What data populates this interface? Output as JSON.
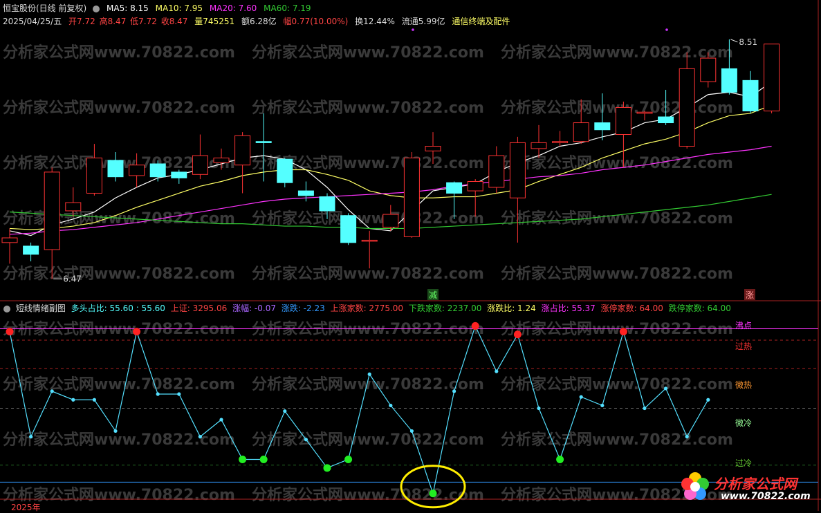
{
  "header": {
    "title": "恒宝股份(日线 前复权)",
    "ma5": "MA5: 8.15",
    "ma10": "MA10: 7.95",
    "ma20": "MA20: 7.60",
    "ma60": "MA60: 7.19",
    "date": "2025/04/25/五",
    "open": "开7.72",
    "high": "高8.47",
    "low": "低7.72",
    "close": "收8.47",
    "volume": "量745251",
    "amount": "额6.28亿",
    "change": "幅0.77(10.00%)",
    "turnover": "换12.44%",
    "float": "流通5.99亿",
    "link": "通信终端及配件"
  },
  "main_chart": {
    "high_label": "8.51",
    "low_label": "6.47",
    "marker_jian": "减",
    "marker_zhang": "涨"
  },
  "sub_header": {
    "title": "短线情绪副图",
    "duokong": "多头占比: 55.60 : 55.60",
    "shangzheng": "上证: 3295.06",
    "zhangfu": "涨幅: -0.07",
    "zhangdie": "涨跌: -2.23",
    "up_count": "上涨家数: 2775.00",
    "down_count": "下跌家数: 2237.00",
    "ratio": "涨跌比: 1.24",
    "up_pct": "涨占比: 55.37",
    "limit_up": "涨停家数: 64.00",
    "limit_down": "跌停家数: 64.00"
  },
  "levels": {
    "boil": "沸点",
    "overheat": "过热",
    "warm": "微热",
    "cool": "微冷",
    "overcold": "过冷"
  },
  "footer": {
    "year": "2025年"
  },
  "watermark": "分析家公式网www.70822.com",
  "brand": {
    "name": "分析家公式网",
    "url": "www.70822.com"
  },
  "colors": {
    "up": "#ff3333",
    "down": "#54ffff",
    "ma5": "#ffffff",
    "ma10": "#ffff66",
    "ma20": "#ff33ff",
    "ma60": "#33cc33",
    "sentiment": "#54e0ff"
  },
  "candles": [
    {
      "o": 6.78,
      "c": 6.82,
      "h": 6.9,
      "l": 6.6
    },
    {
      "o": 6.75,
      "c": 6.68,
      "h": 6.78,
      "l": 6.62
    },
    {
      "o": 6.72,
      "c": 7.38,
      "h": 7.42,
      "l": 6.47
    },
    {
      "o": 7.05,
      "c": 7.12,
      "h": 7.25,
      "l": 7.0
    },
    {
      "o": 7.2,
      "c": 7.5,
      "h": 7.62,
      "l": 7.18
    },
    {
      "o": 7.48,
      "c": 7.34,
      "h": 7.55,
      "l": 7.3
    },
    {
      "o": 7.35,
      "c": 7.44,
      "h": 7.54,
      "l": 7.25
    },
    {
      "o": 7.45,
      "c": 7.34,
      "h": 7.48,
      "l": 7.3
    },
    {
      "o": 7.38,
      "c": 7.33,
      "h": 7.4,
      "l": 7.28
    },
    {
      "o": 7.36,
      "c": 7.52,
      "h": 7.7,
      "l": 7.32
    },
    {
      "o": 7.46,
      "c": 7.5,
      "h": 7.58,
      "l": 7.4
    },
    {
      "o": 7.44,
      "c": 7.69,
      "h": 7.72,
      "l": 7.2
    },
    {
      "o": 7.64,
      "c": 7.63,
      "h": 7.88,
      "l": 7.3
    },
    {
      "o": 7.49,
      "c": 7.29,
      "h": 7.5,
      "l": 7.25
    },
    {
      "o": 7.22,
      "c": 7.18,
      "h": 7.3,
      "l": 7.13
    },
    {
      "o": 7.17,
      "c": 7.05,
      "h": 7.2,
      "l": 6.98
    },
    {
      "o": 7.01,
      "c": 6.78,
      "h": 7.03,
      "l": 6.76
    },
    {
      "o": 6.8,
      "c": 6.8,
      "h": 6.88,
      "l": 6.56
    },
    {
      "o": 6.91,
      "c": 7.02,
      "h": 7.1,
      "l": 6.88
    },
    {
      "o": 6.83,
      "c": 7.5,
      "h": 7.55,
      "l": 6.82
    },
    {
      "o": 7.56,
      "c": 7.6,
      "h": 7.72,
      "l": 7.45
    },
    {
      "o": 7.29,
      "c": 7.2,
      "h": 7.3,
      "l": 6.98
    },
    {
      "o": 7.22,
      "c": 7.3,
      "h": 7.32,
      "l": 7.0
    },
    {
      "o": 7.25,
      "c": 7.52,
      "h": 7.6,
      "l": 7.2
    },
    {
      "o": 7.16,
      "c": 7.63,
      "h": 7.68,
      "l": 6.78
    },
    {
      "o": 7.58,
      "c": 7.63,
      "h": 7.78,
      "l": 7.5
    },
    {
      "o": 7.63,
      "c": 7.64,
      "h": 7.73,
      "l": 7.6
    },
    {
      "o": 7.64,
      "c": 7.8,
      "h": 8.0,
      "l": 7.62
    },
    {
      "o": 7.8,
      "c": 7.74,
      "h": 8.05,
      "l": 7.65
    },
    {
      "o": 7.7,
      "c": 7.93,
      "h": 7.98,
      "l": 7.42
    },
    {
      "o": 7.88,
      "c": 7.89,
      "h": 7.9,
      "l": 7.82
    },
    {
      "o": 7.85,
      "c": 7.8,
      "h": 8.08,
      "l": 7.78
    },
    {
      "o": 7.6,
      "c": 8.26,
      "h": 8.4,
      "l": 7.58
    },
    {
      "o": 8.15,
      "c": 8.35,
      "h": 8.4,
      "l": 8.1
    },
    {
      "o": 8.26,
      "c": 8.06,
      "h": 8.51,
      "l": 8.04
    },
    {
      "o": 8.16,
      "c": 7.9,
      "h": 8.24,
      "l": 7.88
    },
    {
      "o": 7.9,
      "c": 8.47,
      "h": 8.47,
      "l": 7.88
    }
  ],
  "ma_series": {
    "ma5": [
      6.88,
      6.84,
      6.93,
      6.98,
      7.04,
      7.16,
      7.25,
      7.33,
      7.36,
      7.4,
      7.45,
      7.5,
      7.52,
      7.49,
      7.4,
      7.25,
      7.06,
      6.9,
      6.88,
      7.05,
      7.22,
      7.25,
      7.28,
      7.38,
      7.46,
      7.52,
      7.6,
      7.63,
      7.68,
      7.72,
      7.8,
      7.83,
      7.93,
      8.04,
      8.06,
      8.02,
      8.15
    ],
    "ma10": [
      6.9,
      6.89,
      6.9,
      6.92,
      6.95,
      7.01,
      7.08,
      7.14,
      7.2,
      7.26,
      7.3,
      7.35,
      7.38,
      7.4,
      7.4,
      7.36,
      7.31,
      7.22,
      7.18,
      7.16,
      7.16,
      7.17,
      7.17,
      7.2,
      7.23,
      7.3,
      7.36,
      7.42,
      7.5,
      7.56,
      7.62,
      7.66,
      7.72,
      7.8,
      7.86,
      7.88,
      7.95
    ],
    "ma20": [
      6.85,
      6.86,
      6.88,
      6.89,
      6.91,
      6.93,
      6.95,
      6.98,
      7.01,
      7.04,
      7.07,
      7.1,
      7.13,
      7.15,
      7.16,
      7.17,
      7.18,
      7.19,
      7.2,
      7.21,
      7.23,
      7.26,
      7.28,
      7.3,
      7.32,
      7.34,
      7.35,
      7.37,
      7.4,
      7.42,
      7.44,
      7.47,
      7.5,
      7.53,
      7.55,
      7.57,
      7.6
    ],
    "ma60": [
      7.04,
      7.03,
      7.02,
      7.01,
      7.0,
      6.99,
      6.98,
      6.97,
      6.96,
      6.95,
      6.94,
      6.94,
      6.93,
      6.92,
      6.92,
      6.91,
      6.91,
      6.9,
      6.9,
      6.9,
      6.91,
      6.92,
      6.93,
      6.94,
      6.95,
      6.96,
      6.97,
      6.98,
      7.0,
      7.02,
      7.04,
      7.06,
      7.08,
      7.1,
      7.13,
      7.16,
      7.19
    ]
  },
  "sentiment": [
    79,
    42,
    58,
    55,
    55,
    44,
    79,
    57,
    57,
    42,
    48,
    34,
    34,
    51,
    41,
    31,
    34,
    64,
    53,
    44,
    22,
    58,
    81,
    65,
    78,
    52,
    34,
    56,
    53,
    79,
    52,
    59,
    42,
    55
  ]
}
